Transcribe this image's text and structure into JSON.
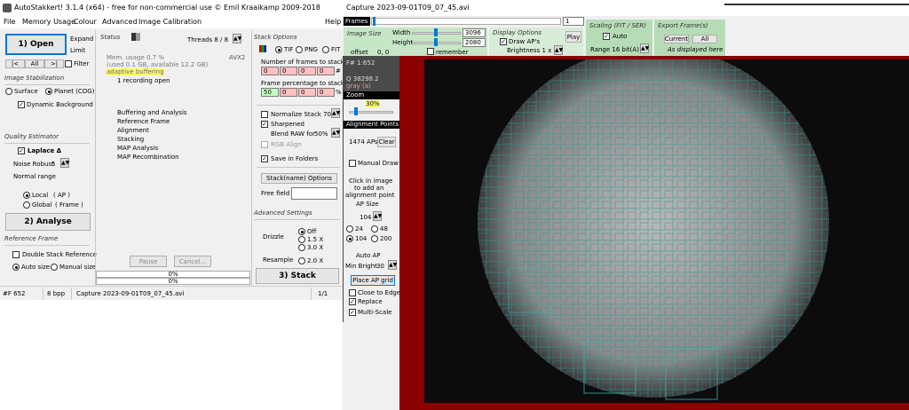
{
  "left_window": {
    "title": "AutoStakkert! 3.1.4 (x64) - free for non-commercial use © Emil Kraaikamp 2009-2018",
    "menu": [
      "File",
      "Memory Usage",
      "Colour",
      "Advanced",
      "Image Calibration",
      "Help"
    ],
    "open_button": "1) Open",
    "expand": "Expand",
    "limit": "Limit",
    "nav": {
      "prev": "|<",
      "all": "All",
      "next": ">|",
      "filter": "Filter"
    },
    "image_stabilization": {
      "title": "Image Stabilization",
      "surface": "Surface",
      "planet": "Planet (COG)",
      "dynamic_bg": "Dynamic Background"
    },
    "quality": {
      "title": "Quality Estimator",
      "laplace": "Laplace Δ",
      "noise_robust": "Noise Robust",
      "noise_value": "5",
      "normal_range": "Normal range",
      "local": "Local",
      "local_ap": "( AP )",
      "global": "Global",
      "global_frame": "( Frame )"
    },
    "analyse_button": "2) Analyse",
    "reference": {
      "title": "Reference Frame",
      "double_stack": "Double Stack Reference",
      "auto_size": "Auto size",
      "manual_size": "Manual size"
    },
    "status": {
      "title": "Status",
      "threads": "Threads 8 / 8",
      "avx": "AVX2",
      "mem1": "Mem. usage 0.7 %",
      "mem2": "(used 0.1 GB, available 12.2 GB)",
      "adaptive": "adaptive buffering",
      "recording": "1 recording open",
      "steps": [
        "Buffering and Analysis",
        "Reference Frame",
        "Alignment",
        "Stacking",
        "MAP Analysis",
        "MAP Recombination"
      ],
      "pause": "Pause",
      "cancel": "Cancel...",
      "progress1": "0%",
      "progress2": "0%"
    },
    "stack_options": {
      "title": "Stack Options",
      "tif": "TIF",
      "png": "PNG",
      "fit": "FIT",
      "num_frames_label": "Number of frames to stack:",
      "num_frames": [
        "0",
        "0",
        "0",
        "0"
      ],
      "hash": "#",
      "percent_label": "Frame percentage to stack:",
      "percent": [
        "50",
        "0",
        "0",
        "0"
      ],
      "pct": "%",
      "normalize": "Normalize Stack 70%",
      "sharpened": "Sharpened",
      "blend_raw": "Blend RAW for",
      "blend_value": "50%",
      "rgb_align": "RGB Align",
      "save_folders": "Save in Folders",
      "stack_name_btn": "Stack(name) Options",
      "free_field": "Free field"
    },
    "advanced": {
      "title": "Advanced Settings",
      "drizzle": "Drizzle",
      "off": "Off",
      "x15": "1.5 X",
      "x30": "3.0 X",
      "resample": "Resample",
      "x20": "2.0 X"
    },
    "stack_button": "3) Stack",
    "statusbar": {
      "frames": "#F 652",
      "bpp": "8 bpp",
      "file": "Capture 2023-09-01T09_07_45.avi",
      "page": "1/1"
    }
  },
  "right_window": {
    "title": "Capture 2023-09-01T09_07_45.avi",
    "frames_label": "Frames",
    "frame_value": "1",
    "frame_pos": 0.01,
    "image_size": {
      "title": "Image Size",
      "width_label": "Width",
      "width": "3096",
      "height_label": "Height",
      "height": "2080",
      "offset_label": "offset",
      "offset": "0, 0",
      "remember": "remember"
    },
    "display": {
      "title": "Display Options",
      "draw_aps": "Draw AP's",
      "brightness": "Brightness 1 x",
      "play": "Play"
    },
    "scaling": {
      "title": "Scaling (FIT / SER)",
      "auto": "Auto",
      "range": "Range 16 bit(A)"
    },
    "export": {
      "title": "Export Frame(s)",
      "current": "Current",
      "all": "All",
      "as_displayed": "As displayed here"
    },
    "side": {
      "frame_num": "F# 1:652",
      "q_value": "Q 38298.2",
      "gray": "gray (a)",
      "zoom_label": "Zoom",
      "zoom_value": "30%",
      "zoom_level": 0.12,
      "ap_label": "Alignment Points",
      "aps": "1474 APs",
      "clear": "Clear",
      "manual_draw": "Manual Draw",
      "click_text": [
        "Click in image",
        "to add an",
        "alignment point"
      ],
      "ap_size": "AP Size",
      "ap_size_value": "104",
      "ap_24": "24",
      "ap_48": "48",
      "ap_104": "104",
      "ap_200": "200",
      "auto_ap": "Auto AP",
      "min_bright": "Min Bright",
      "min_bright_value": "30",
      "place_grid": "Place AP grid",
      "close_edge": "Close to Edge",
      "replace": "Replace",
      "multi_scale": "Multi-Scale"
    }
  },
  "colors": {
    "accent": "#0078d7",
    "green_panel": "#c6e6c6",
    "red_bg": "#8b0000",
    "ap_grid": "#2a9a9a",
    "adaptive_highlight": "#ffff66"
  }
}
